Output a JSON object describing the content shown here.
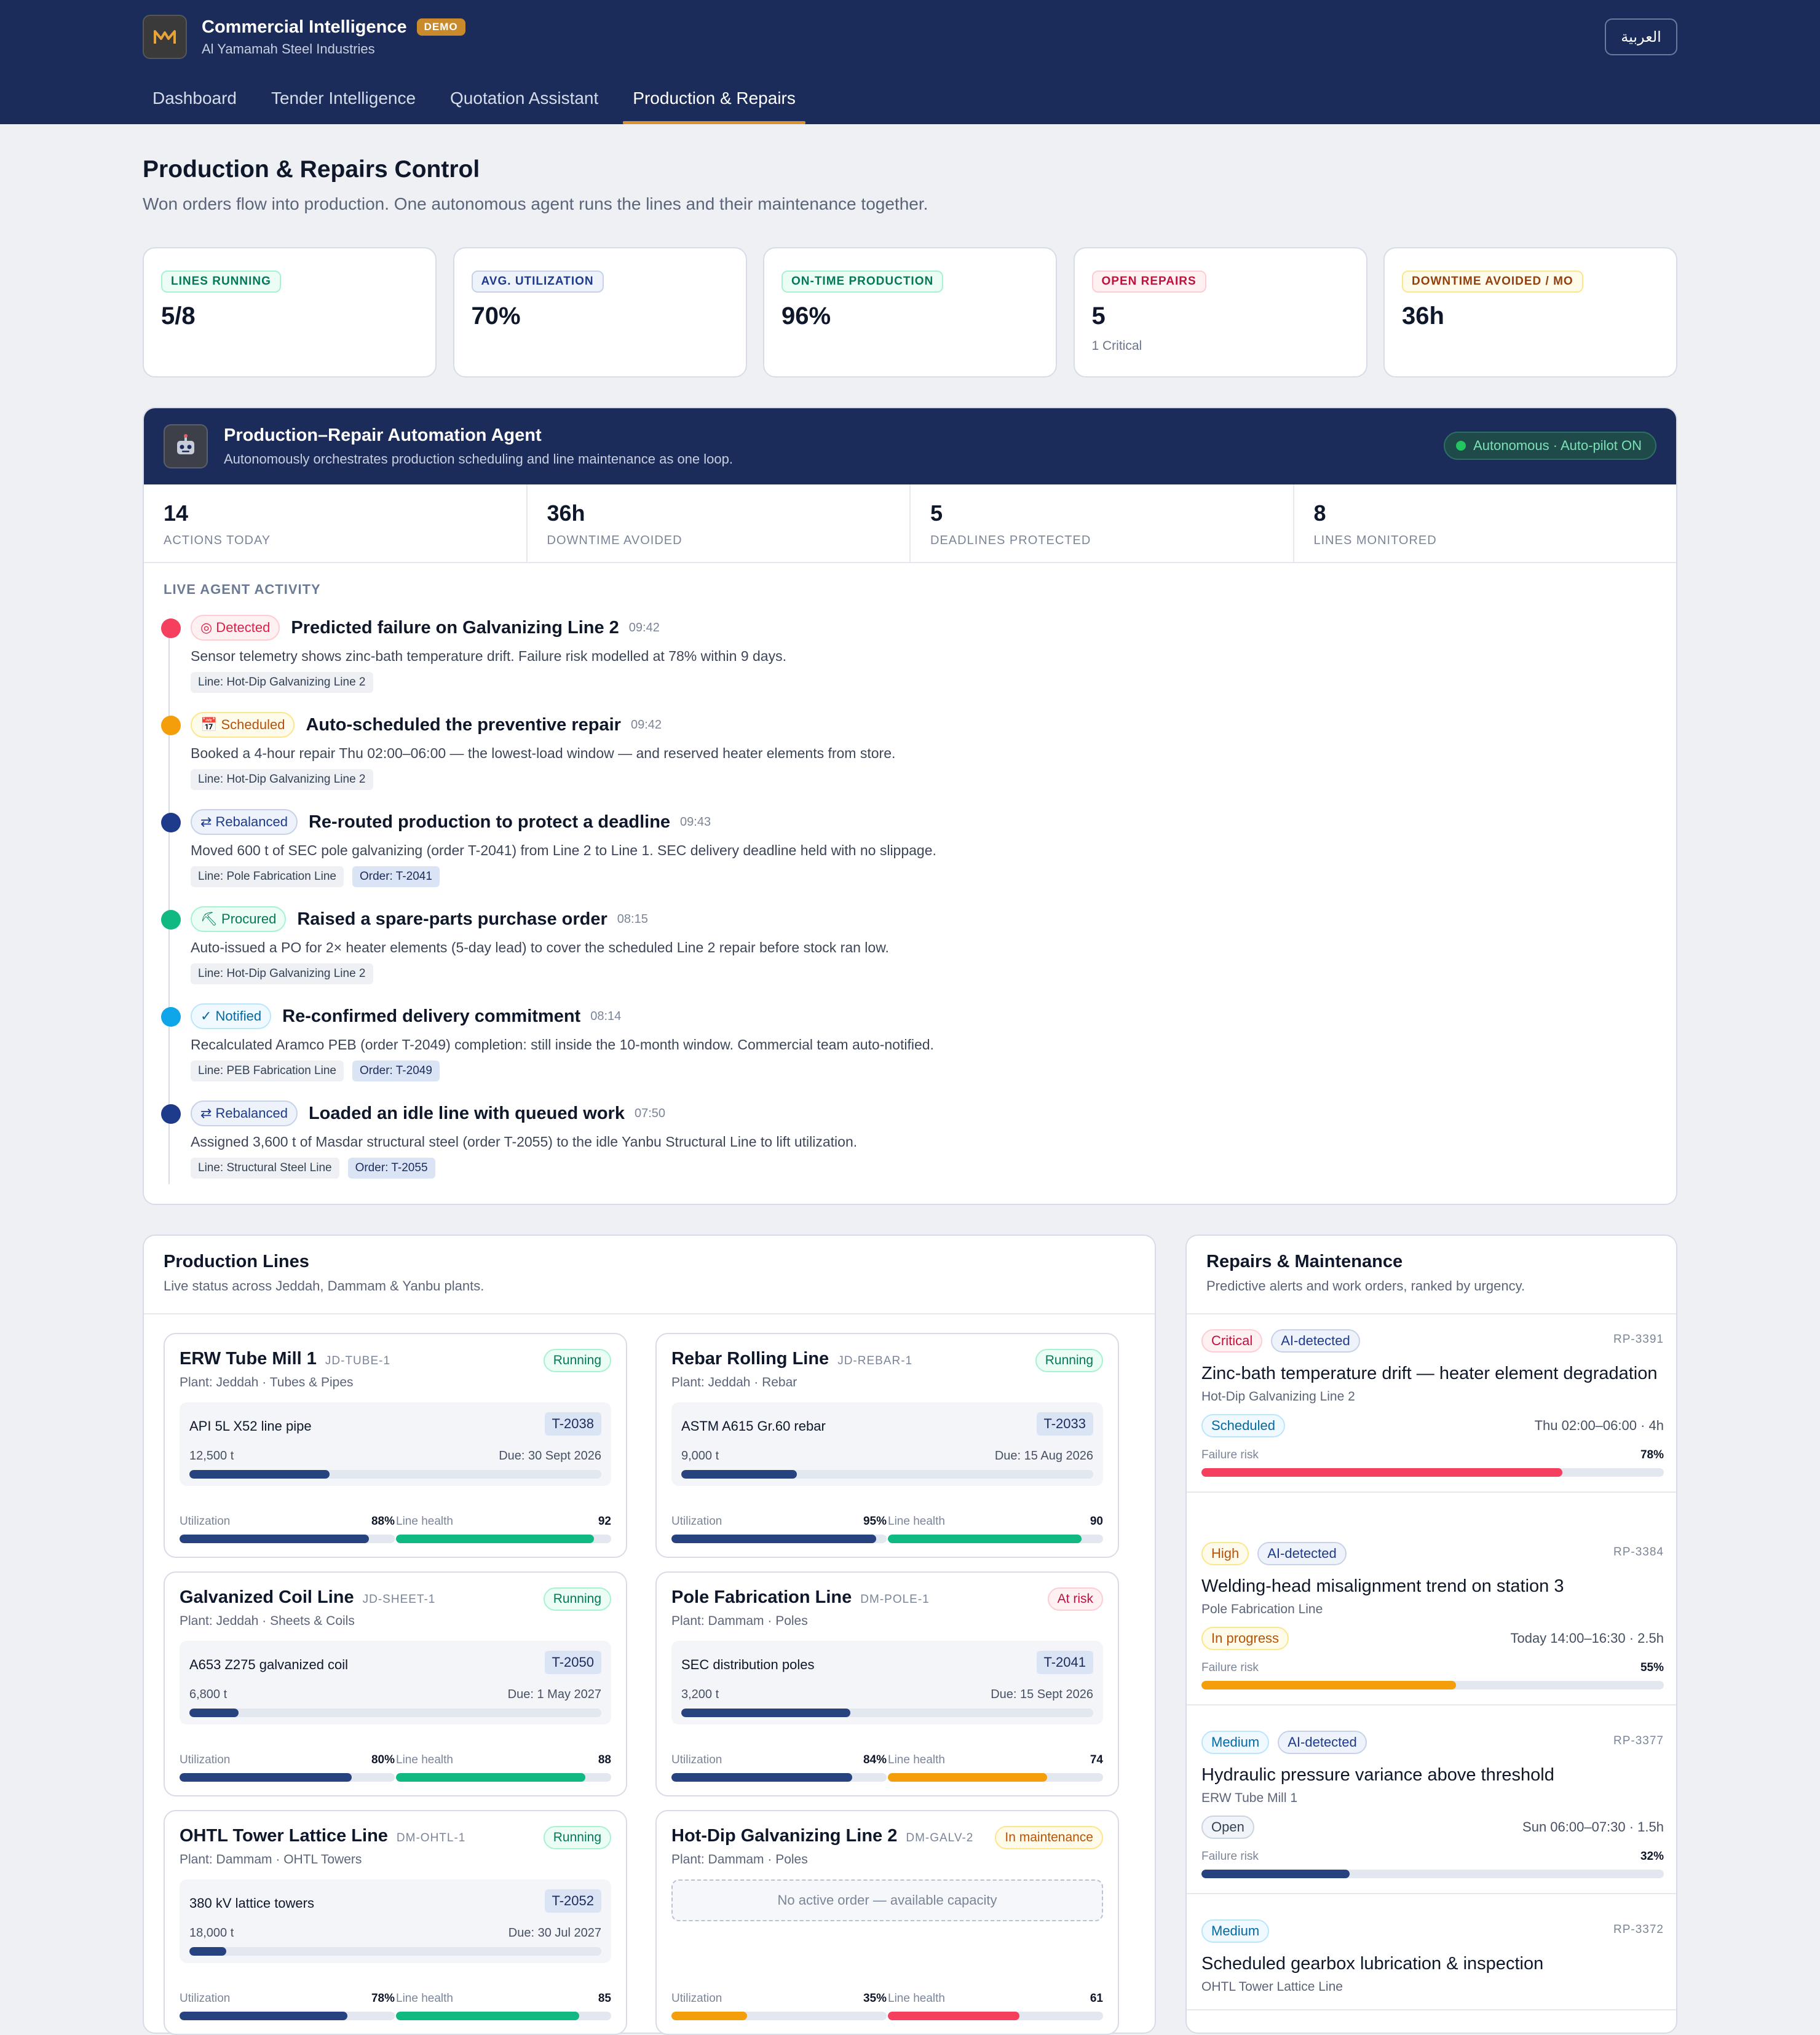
{
  "header": {
    "app_title": "Commercial Intelligence",
    "demo_badge": "DEMO",
    "company": "Al Yamamah Steel Industries",
    "lang_button": "العربية",
    "tabs": [
      {
        "label": "Dashboard",
        "active": false
      },
      {
        "label": "Tender Intelligence",
        "active": false
      },
      {
        "label": "Quotation Assistant",
        "active": false
      },
      {
        "label": "Production & Repairs",
        "active": true
      }
    ]
  },
  "page": {
    "title": "Production & Repairs Control",
    "subtitle": "Won orders flow into production. One autonomous agent runs the lines and their maintenance together."
  },
  "kpis": [
    {
      "label": "LINES RUNNING",
      "value": "5/8",
      "sub": "",
      "color": "#16a34a"
    },
    {
      "label": "AVG. UTILIZATION",
      "value": "70%",
      "sub": "",
      "color": "#26427f"
    },
    {
      "label": "ON-TIME PRODUCTION",
      "value": "96%",
      "sub": "",
      "color": "#16a34a"
    },
    {
      "label": "OPEN REPAIRS",
      "value": "5",
      "sub": "1 Critical",
      "color": "#dc2626"
    },
    {
      "label": "DOWNTIME AVOIDED / MO",
      "value": "36h",
      "sub": "",
      "color": "#d97706"
    }
  ],
  "agent": {
    "title": "Production–Repair Automation Agent",
    "subtitle": "Autonomously orchestrates production scheduling and line maintenance as one loop.",
    "status": "Autonomous · Auto-pilot ON",
    "stats": [
      {
        "value": "14",
        "label": "ACTIONS TODAY"
      },
      {
        "value": "36h",
        "label": "DOWNTIME AVOIDED"
      },
      {
        "value": "5",
        "label": "DEADLINES PROTECTED"
      },
      {
        "value": "8",
        "label": "LINES MONITORED"
      }
    ],
    "activity_label": "LIVE AGENT ACTIVITY",
    "activity": [
      {
        "badge": "◎ Detected",
        "title": "Predicted failure on Galvanizing Line 2",
        "time": "09:42",
        "desc": "Sensor telemetry shows zinc-bath temperature drift. Failure risk modelled at 78% within 9 days.",
        "tags": [
          "Line: Hot-Dip Galvanizing Line 2"
        ],
        "order": "",
        "dot": "#f43f5e",
        "badge_color": "#e11d48",
        "badge_bg": "#fff1f2",
        "badge_border": "#fecdd3"
      },
      {
        "badge": "📅 Scheduled",
        "title": "Auto-scheduled the preventive repair",
        "time": "09:42",
        "desc": "Booked a 4-hour repair Thu 02:00–06:00 — the lowest-load window — and reserved heater elements from store.",
        "tags": [
          "Line: Hot-Dip Galvanizing Line 2"
        ],
        "order": "",
        "dot": "#f59e0b",
        "badge_color": "#b45309",
        "badge_bg": "#fffbeb",
        "badge_border": "#fde68a"
      },
      {
        "badge": "⇄ Rebalanced",
        "title": "Re-routed production to protect a deadline",
        "time": "09:43",
        "desc": "Moved 600 t of SEC pole galvanizing (order T-2041) from Line 2 to Line 1. SEC delivery deadline held with no slippage.",
        "tags": [
          "Line: Pole Fabrication Line"
        ],
        "order": "Order: T-2041",
        "dot": "#1e3a8a",
        "badge_color": "#1e3a8a",
        "badge_bg": "#eef2fa",
        "badge_border": "#c7d2e8"
      },
      {
        "badge": "⛏ Procured",
        "title": "Raised a spare-parts purchase order",
        "time": "08:15",
        "desc": "Auto-issued a PO for 2× heater elements (5-day lead) to cover the scheduled Line 2 repair before stock ran low.",
        "tags": [
          "Line: Hot-Dip Galvanizing Line 2"
        ],
        "order": "",
        "dot": "#10b981",
        "badge_color": "#047857",
        "badge_bg": "#ecfdf5",
        "badge_border": "#a7f3d0"
      },
      {
        "badge": "✓ Notified",
        "title": "Re-confirmed delivery commitment",
        "time": "08:14",
        "desc": "Recalculated Aramco PEB (order T-2049) completion: still inside the 10-month window. Commercial team auto-notified.",
        "tags": [
          "Line: PEB Fabrication Line"
        ],
        "order": "Order: T-2049",
        "dot": "#0ea5e9",
        "badge_color": "#0369a1",
        "badge_bg": "#f0f9ff",
        "badge_border": "#bae6fd"
      },
      {
        "badge": "⇄ Rebalanced",
        "title": "Loaded an idle line with queued work",
        "time": "07:50",
        "desc": "Assigned 3,600 t of Masdar structural steel (order T-2055) to the idle Yanbu Structural Line to lift utilization.",
        "tags": [
          "Line: Structural Steel Line"
        ],
        "order": "Order: T-2055",
        "dot": "#1e3a8a",
        "badge_color": "#1e3a8a",
        "badge_bg": "#eef2fa",
        "badge_border": "#c7d2e8"
      }
    ]
  },
  "production": {
    "title": "Production Lines",
    "subtitle": "Live status across Jeddah, Dammam & Yanbu plants.",
    "util_label": "Utilization",
    "health_label": "Line health",
    "lines": [
      {
        "name": "ERW Tube Mill 1",
        "code": "JD-TUBE-1",
        "status": "Running",
        "status_kind": "running",
        "plant": "Plant: Jeddah · Tubes & Pipes",
        "order_name": "API 5L X52 line pipe",
        "order_id": "T-2038",
        "qty": "12,500 t",
        "due": "Due: 30 Sept 2026",
        "progress": 0.34,
        "util": "88%",
        "util_v": 0.88,
        "health": "92",
        "health_v": 0.92,
        "util_color": "#26427f",
        "health_color": "#10b981"
      },
      {
        "name": "Rebar Rolling Line",
        "code": "JD-REBAR-1",
        "status": "Running",
        "status_kind": "running",
        "plant": "Plant: Jeddah · Rebar",
        "order_name": "ASTM A615 Gr.60 rebar",
        "order_id": "T-2033",
        "qty": "9,000 t",
        "due": "Due: 15 Aug 2026",
        "progress": 0.28,
        "util": "95%",
        "util_v": 0.95,
        "health": "90",
        "health_v": 0.9,
        "util_color": "#26427f",
        "health_color": "#10b981"
      },
      {
        "name": "Galvanized Coil Line",
        "code": "JD-SHEET-1",
        "status": "Running",
        "status_kind": "running",
        "plant": "Plant: Jeddah · Sheets & Coils",
        "order_name": "A653 Z275 galvanized coil",
        "order_id": "T-2050",
        "qty": "6,800 t",
        "due": "Due: 1 May 2027",
        "progress": 0.12,
        "util": "80%",
        "util_v": 0.8,
        "health": "88",
        "health_v": 0.88,
        "util_color": "#26427f",
        "health_color": "#10b981"
      },
      {
        "name": "Pole Fabrication Line",
        "code": "DM-POLE-1",
        "status": "At risk",
        "status_kind": "risk",
        "plant": "Plant: Dammam · Poles",
        "order_name": "SEC distribution poles",
        "order_id": "T-2041",
        "qty": "3,200 t",
        "due": "Due: 15 Sept 2026",
        "progress": 0.41,
        "util": "84%",
        "util_v": 0.84,
        "health": "74",
        "health_v": 0.74,
        "util_color": "#26427f",
        "health_color": "#f59e0b"
      },
      {
        "name": "OHTL Tower Lattice Line",
        "code": "DM-OHTL-1",
        "status": "Running",
        "status_kind": "running",
        "plant": "Plant: Dammam · OHTL Towers",
        "order_name": "380 kV lattice towers",
        "order_id": "T-2052",
        "qty": "18,000 t",
        "due": "Due: 30 Jul 2027",
        "progress": 0.09,
        "util": "78%",
        "util_v": 0.78,
        "health": "85",
        "health_v": 0.85,
        "util_color": "#26427f",
        "health_color": "#10b981"
      },
      {
        "name": "Hot-Dip Galvanizing Line 2",
        "code": "DM-GALV-2",
        "status": "In maintenance",
        "status_kind": "maint",
        "plant": "Plant: Dammam · Poles",
        "empty": "No active order — available capacity",
        "util": "35%",
        "util_v": 0.35,
        "health": "61",
        "health_v": 0.61,
        "util_color": "#f59e0b",
        "health_color": "#f43f5e"
      }
    ]
  },
  "repairs": {
    "title": "Repairs & Maintenance",
    "subtitle": "Predictive alerts and work orders, ranked by urgency.",
    "risk_label": "Failure risk",
    "items": [
      {
        "priority": "Critical",
        "pri_kind": "critical",
        "source": "AI-detected",
        "id": "RP-3391",
        "title": "Zinc-bath temperature drift — heater element degradation",
        "line": "Hot-Dip Galvanizing Line 2",
        "state": "Scheduled",
        "state_kind": "scheduled",
        "when": "Thu 02:00–06:00 · 4h",
        "risk": "78%",
        "risk_v": 0.78,
        "risk_color": "#f43f5e"
      },
      {
        "priority": "High",
        "pri_kind": "high",
        "source": "AI-detected",
        "id": "RP-3384",
        "title": "Welding-head misalignment trend on station 3",
        "line": "Pole Fabrication Line",
        "state": "In progress",
        "state_kind": "progress",
        "when": "Today 14:00–16:30 · 2.5h",
        "risk": "55%",
        "risk_v": 0.55,
        "risk_color": "#f59e0b"
      },
      {
        "priority": "Medium",
        "pri_kind": "medium",
        "source": "AI-detected",
        "id": "RP-3377",
        "title": "Hydraulic pressure variance above threshold",
        "line": "ERW Tube Mill 1",
        "state": "Open",
        "state_kind": "open",
        "when": "Sun 06:00–07:30 · 1.5h",
        "risk": "32%",
        "risk_v": 0.32,
        "risk_color": "#26427f"
      },
      {
        "priority": "Medium",
        "pri_kind": "medium",
        "source": "",
        "id": "RP-3372",
        "title": "Scheduled gearbox lubrication & inspection",
        "line": "OHTL Tower Lattice Line",
        "state": "",
        "state_kind": "",
        "when": "",
        "risk": "",
        "risk_v": 0,
        "risk_color": "#26427f"
      }
    ]
  }
}
